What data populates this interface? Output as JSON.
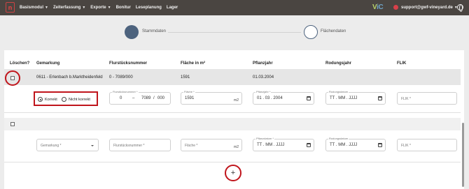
{
  "nav": {
    "items": [
      {
        "label": "Basismodul",
        "dropdown": true
      },
      {
        "label": "Zeiterfassung",
        "dropdown": true
      },
      {
        "label": "Exporte",
        "dropdown": true
      },
      {
        "label": "Bonitur",
        "dropdown": false
      },
      {
        "label": "Leseplanung",
        "dropdown": false
      },
      {
        "label": "Lager",
        "dropdown": false
      }
    ],
    "brand_left": "V",
    "brand_right": "iC",
    "account": "support@gwf-vineyard.de"
  },
  "stepper": {
    "step1": "Stammdaten",
    "step2": "Flächendaten"
  },
  "table": {
    "headers": {
      "loeschen": "Löschen?",
      "gemarkung": "Gemarkung",
      "flurstueck": "Flurstücksnummer",
      "flaeche": "Fläche in m²",
      "pflanzjahr": "Pflanzjahr",
      "rodungsjahr": "Rodungsjahr",
      "flik": "FLIK"
    },
    "row1": {
      "gemarkung": "0611 - Erlenbach b.Marktheidenfeld",
      "flurstueck": "0 - 7089/000",
      "flaeche": "1591",
      "pflanzjahr": "01.03.2004"
    },
    "edit1": {
      "radio_korrekt": "Korrekt",
      "radio_nicht_korrekt": "Nicht korrekt",
      "selected": "Korrekt",
      "flurstueck_label": "Flurstücksnummer *",
      "flur_a": "0",
      "flur_sep1": "–",
      "flur_b": "7089",
      "flur_sep2": "/",
      "flur_c": "000",
      "flaeche_label": "Fläche *",
      "flaeche_value": "1591",
      "flaeche_unit": "m2",
      "pflanzjahr_label": "Pflanzjahr *",
      "pflanzjahr_value": "01 . 03 . 2004",
      "rodung_label": "Rodungsdatum",
      "rodung_value": "TT . MM . JJJJ",
      "flik_placeholder": "FLIK *"
    },
    "edit2": {
      "gemarkung_placeholder": "Gemarkung *",
      "flurstueck_placeholder": "Flurstücksnummer *",
      "flaeche_placeholder": "Fläche *",
      "flaeche_unit": "m2",
      "pflanzjahr_label": "Pflanzdatum *",
      "pflanzjahr_value": "TT . MM . JJJJ",
      "rodung_label": "Rodungsdatum",
      "rodung_value": "TT . MM . JJJJ",
      "flik_placeholder": "FLIK *"
    },
    "add_label": "+"
  },
  "colors": {
    "topbar": "#4a4541",
    "step_active": "#4d637e",
    "highlight": "#c0151c"
  }
}
